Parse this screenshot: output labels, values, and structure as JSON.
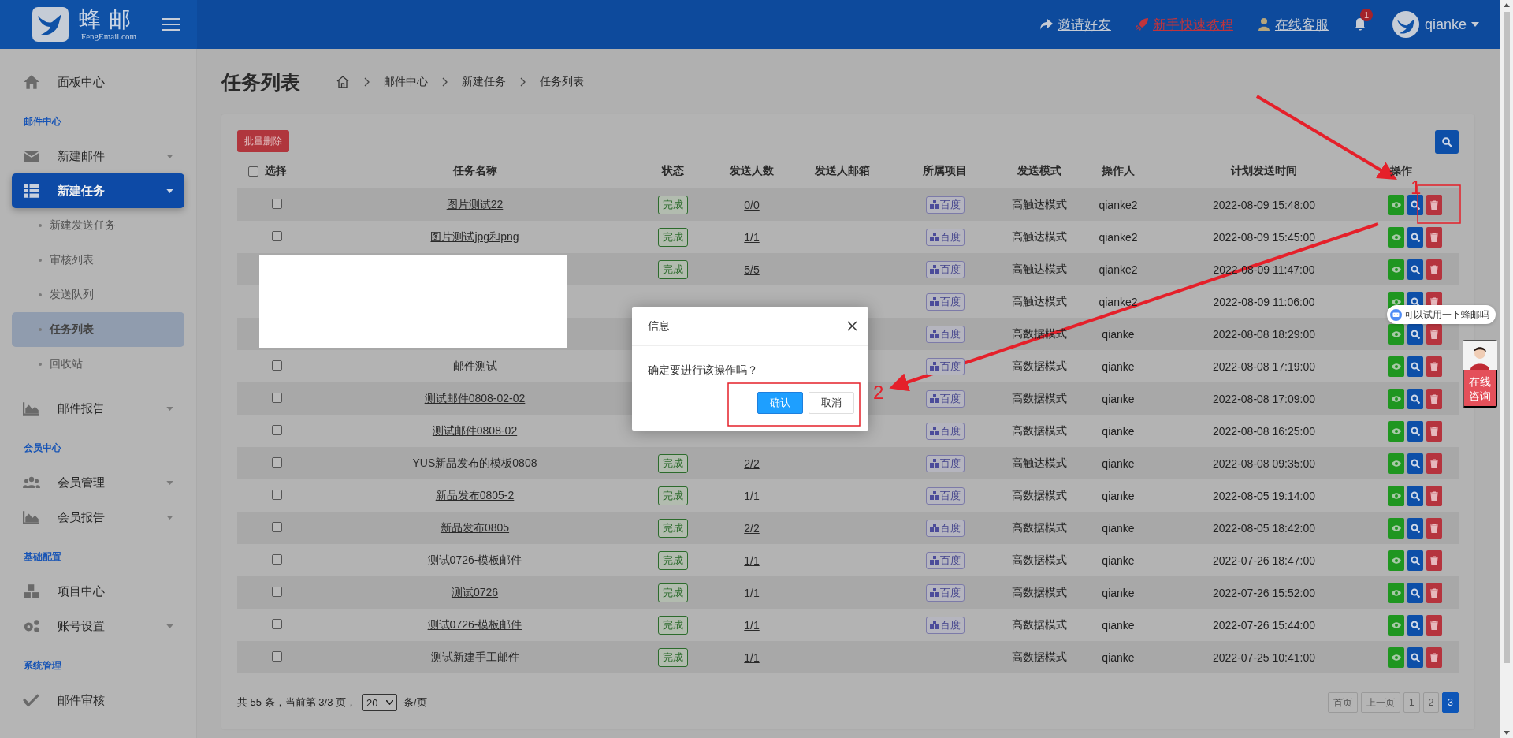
{
  "header": {
    "logo_title": "蜂邮",
    "logo_subtitle": "FengEmail.com",
    "links": [
      {
        "kind": "invite",
        "label": "邀请好友"
      },
      {
        "kind": "tutorial",
        "label": "新手快速教程"
      },
      {
        "kind": "service",
        "label": "在线客服"
      }
    ],
    "notification_count": "1",
    "user_name": "qianke"
  },
  "sidebar": {
    "items": [
      {
        "kind": "link",
        "label": "面板中心",
        "expandable": false,
        "selected": false
      },
      {
        "kind": "heading",
        "label": "邮件中心"
      },
      {
        "kind": "link",
        "label": "新建邮件",
        "expandable": true,
        "selected": false
      },
      {
        "kind": "link",
        "label": "新建任务",
        "expandable": true,
        "selected": true,
        "children": [
          {
            "label": "新建发送任务",
            "selected": false
          },
          {
            "label": "审核列表",
            "selected": false
          },
          {
            "label": "发送队列",
            "selected": false
          },
          {
            "label": "任务列表",
            "selected": true
          },
          {
            "label": "回收站",
            "selected": false
          }
        ]
      },
      {
        "kind": "link",
        "label": "邮件报告",
        "expandable": true,
        "selected": false
      },
      {
        "kind": "heading",
        "label": "会员中心"
      },
      {
        "kind": "link",
        "label": "会员管理",
        "expandable": true,
        "selected": false
      },
      {
        "kind": "link",
        "label": "会员报告",
        "expandable": true,
        "selected": false
      },
      {
        "kind": "heading",
        "label": "基础配置"
      },
      {
        "kind": "link",
        "label": "项目中心",
        "expandable": false,
        "selected": false
      },
      {
        "kind": "link",
        "label": "账号设置",
        "expandable": true,
        "selected": false
      },
      {
        "kind": "heading",
        "label": "系统管理"
      },
      {
        "kind": "link",
        "label": "邮件审核",
        "expandable": false,
        "selected": false
      }
    ]
  },
  "page_title": "任务列表",
  "breadcrumb": [
    "邮件中心",
    "新建任务",
    "任务列表"
  ],
  "toolbar": {
    "bulk_delete": "批量删除"
  },
  "table": {
    "select_all_checked": false,
    "columns": [
      "选择",
      "任务名称",
      "状态",
      "发送人数",
      "发送人邮箱",
      "所属项目",
      "发送模式",
      "操作人",
      "计划发送时间",
      "操作"
    ],
    "rows": [
      {
        "checked": false,
        "name": "图片测试22",
        "status": "完成",
        "count": "0/0",
        "project": "百度",
        "mode": "高触达模式",
        "operator": "qianke2",
        "time": "2022-08-09 15:48:00"
      },
      {
        "checked": false,
        "name": "图片测试jpg和png",
        "status": "完成",
        "count": "1/1",
        "project": "百度",
        "mode": "高触达模式",
        "operator": "qianke2",
        "time": "2022-08-09 15:45:00"
      },
      {
        "status": "完成",
        "count": "5/5",
        "project": "百度",
        "mode": "高触达模式",
        "operator": "qianke2",
        "time": "2022-08-09 11:47:00"
      },
      {
        "project": "百度",
        "mode": "高触达模式",
        "operator": "qianke2",
        "time": "2022-08-09 11:06:00"
      },
      {
        "project": "百度",
        "mode": "高数据模式",
        "operator": "qianke",
        "time": "2022-08-08 18:29:00"
      },
      {
        "checked": false,
        "name": "邮件测试",
        "project": "百度",
        "mode": "高数据模式",
        "operator": "qianke",
        "time": "2022-08-08 17:19:00"
      },
      {
        "checked": false,
        "name": "测试邮件0808-02-02",
        "project": "百度",
        "mode": "高数据模式",
        "operator": "qianke",
        "time": "2022-08-08 17:09:00"
      },
      {
        "checked": false,
        "name": "测试邮件0808-02",
        "project": "百度",
        "mode": "高数据模式",
        "operator": "qianke",
        "time": "2022-08-08 16:25:00"
      },
      {
        "checked": false,
        "name": "YUS新品发布的模板0808",
        "status": "完成",
        "count": "2/2",
        "project": "百度",
        "mode": "高触达模式",
        "operator": "qianke",
        "time": "2022-08-08 09:35:00"
      },
      {
        "checked": false,
        "name": "新品发布0805-2",
        "status": "完成",
        "count": "1/1",
        "project": "百度",
        "mode": "高数据模式",
        "operator": "qianke",
        "time": "2022-08-05 19:14:00"
      },
      {
        "checked": false,
        "name": "新品发布0805",
        "status": "完成",
        "count": "2/2",
        "project": "百度",
        "mode": "高数据模式",
        "operator": "qianke",
        "time": "2022-08-05 18:42:00"
      },
      {
        "checked": false,
        "name": "测试0726-模板邮件",
        "status": "完成",
        "count": "1/1",
        "project": "百度",
        "mode": "高数据模式",
        "operator": "qianke",
        "time": "2022-07-26 18:47:00"
      },
      {
        "checked": false,
        "name": "测试0726",
        "status": "完成",
        "count": "1/1",
        "project": "百度",
        "mode": "高数据模式",
        "operator": "qianke",
        "time": "2022-07-26 15:52:00"
      },
      {
        "checked": false,
        "name": "测试0726-模板邮件",
        "status": "完成",
        "count": "1/1",
        "project": "百度",
        "mode": "高数据模式",
        "operator": "qianke",
        "time": "2022-07-26 15:44:00"
      },
      {
        "checked": false,
        "name": "测试新建手工邮件",
        "status": "完成",
        "count": "1/1",
        "mode": "高数据模式",
        "operator": "qianke",
        "time": "2022-07-25 10:41:00"
      }
    ]
  },
  "footer": {
    "summary": "共 55 条，当前第 3/3 页，",
    "page_size": "20",
    "page_size_suffix": "条/页"
  },
  "pagination": [
    {
      "label": "首页",
      "selected": false
    },
    {
      "label": "上一页",
      "selected": false
    },
    {
      "label": "1",
      "selected": false
    },
    {
      "label": "2",
      "selected": false
    },
    {
      "label": "3",
      "selected": true
    }
  ],
  "dialog": {
    "title": "信息",
    "message": "确定要进行该操作吗？",
    "buttons": [
      {
        "kind": "primary",
        "label": "确认"
      },
      {
        "kind": "default",
        "label": "取消"
      }
    ]
  },
  "chat_widget": {
    "bubble": "可以试用一下蜂邮吗",
    "button": "在线咨询"
  },
  "annotations": [
    {
      "label": "1"
    },
    {
      "label": "2"
    }
  ]
}
